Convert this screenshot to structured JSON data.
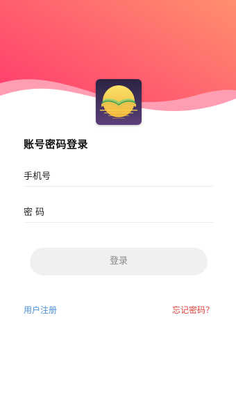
{
  "header": {
    "gradient_start": "#ff2f6e",
    "gradient_end": "#ff8f6f",
    "wave_color": "#ff9db2"
  },
  "logo": {
    "icon": "open-book-sun-icon",
    "background": "#3b2c5a",
    "sun_color": "#f6d24f"
  },
  "form": {
    "title": "账号密码登录",
    "phone_placeholder": "手机号",
    "password_placeholder": "密码",
    "login_label": "登录"
  },
  "links": {
    "register": "用户注册",
    "forgot": "忘记密码？"
  }
}
